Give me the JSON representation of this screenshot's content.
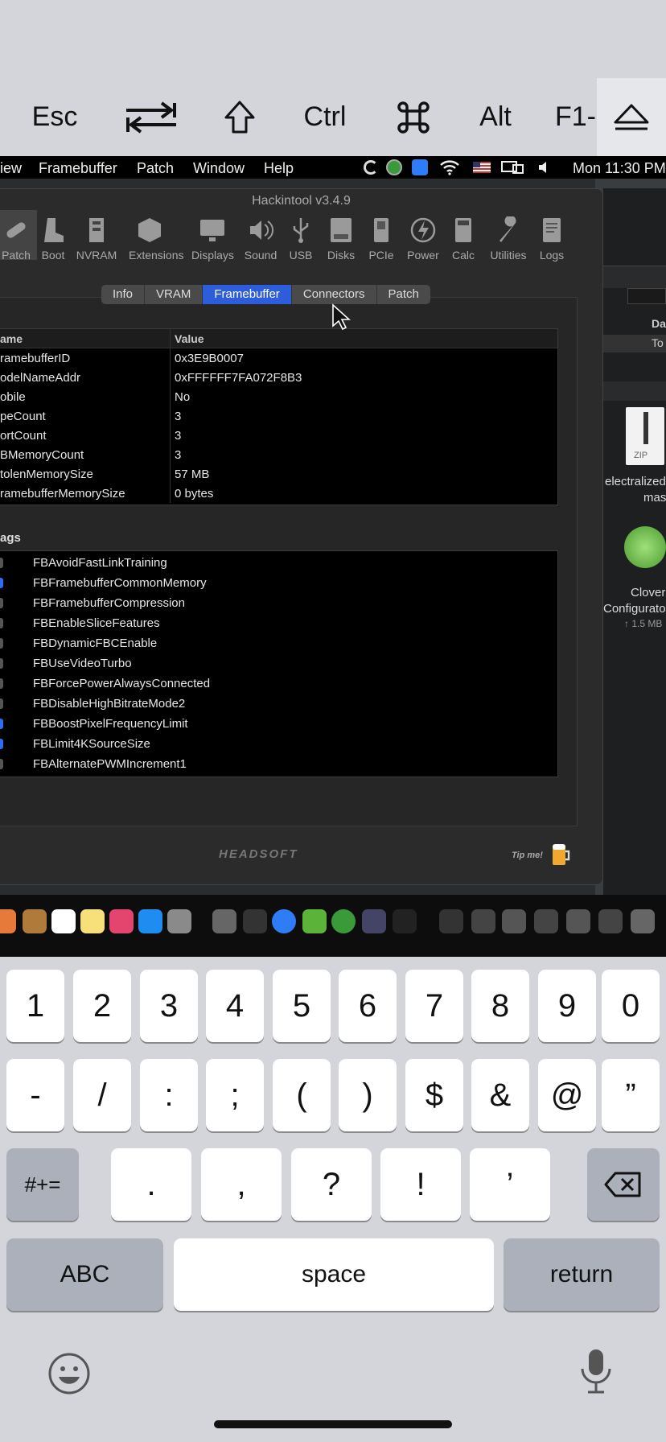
{
  "special_keys": [
    "Esc",
    "Ctrl",
    "Alt",
    "F1-"
  ],
  "menubar": {
    "items": [
      "iew",
      "Framebuffer",
      "Patch",
      "Window",
      "Help"
    ],
    "clock": "Mon 11:30 PM"
  },
  "window": {
    "title": "Hackintool v3.4.9",
    "toolbar": [
      "Patch",
      "Boot",
      "NVRAM",
      "Extensions",
      "Displays",
      "Sound",
      "USB",
      "Disks",
      "PCIe",
      "Power",
      "Calc",
      "Utilities",
      "Logs"
    ],
    "tabs": [
      "Info",
      "VRAM",
      "Framebuffer",
      "Connectors",
      "Patch"
    ],
    "active_tab": "Framebuffer",
    "table_header": {
      "name": "ame",
      "value": "Value"
    },
    "rows": [
      {
        "name": "ramebufferID",
        "value": "0x3E9B0007"
      },
      {
        "name": "odelNameAddr",
        "value": "0xFFFFFF7FA072F8B3"
      },
      {
        "name": "obile",
        "value": "No"
      },
      {
        "name": "peCount",
        "value": "3"
      },
      {
        "name": "ortCount",
        "value": "3"
      },
      {
        "name": "BMemoryCount",
        "value": "3"
      },
      {
        "name": "tolenMemorySize",
        "value": "57 MB"
      },
      {
        "name": "ramebufferMemorySize",
        "value": "0 bytes"
      }
    ],
    "flags_label": "ags",
    "flags": [
      {
        "name": "FBAvoidFastLinkTraining",
        "on": false
      },
      {
        "name": "FBFramebufferCommonMemory",
        "on": true
      },
      {
        "name": "FBFramebufferCompression",
        "on": false
      },
      {
        "name": "FBEnableSliceFeatures",
        "on": false
      },
      {
        "name": "FBDynamicFBCEnable",
        "on": false
      },
      {
        "name": "FBUseVideoTurbo",
        "on": false
      },
      {
        "name": "FBForcePowerAlwaysConnected",
        "on": false
      },
      {
        "name": "FBDisableHighBitrateMode2",
        "on": false
      },
      {
        "name": "FBBoostPixelFrequencyLimit",
        "on": true
      },
      {
        "name": "FBLimit4KSourceSize",
        "on": true
      },
      {
        "name": "FBAlternatePWMIncrement1",
        "on": false
      }
    ],
    "footer_logo": "HEADSOFT",
    "tip": "Tip me!"
  },
  "right_pane": {
    "col_label": "Da",
    "row_label": "To",
    "zip_label": "ZIP",
    "file1": "electralized",
    "file1_sub": "master",
    "file2": "Clover",
    "file2_sub": "Configurato",
    "file2_size": "↑ 1.5 MB"
  },
  "keyboard": {
    "row1": [
      "1",
      "2",
      "3",
      "4",
      "5",
      "6",
      "7",
      "8",
      "9",
      "0"
    ],
    "row2": [
      "-",
      "/",
      ":",
      ";",
      "(",
      ")",
      "$",
      "&",
      "@",
      "”"
    ],
    "row3": [
      "#+=",
      ".",
      ",",
      "?",
      "!",
      "’"
    ],
    "abc": "ABC",
    "space": "space",
    "return": "return"
  }
}
